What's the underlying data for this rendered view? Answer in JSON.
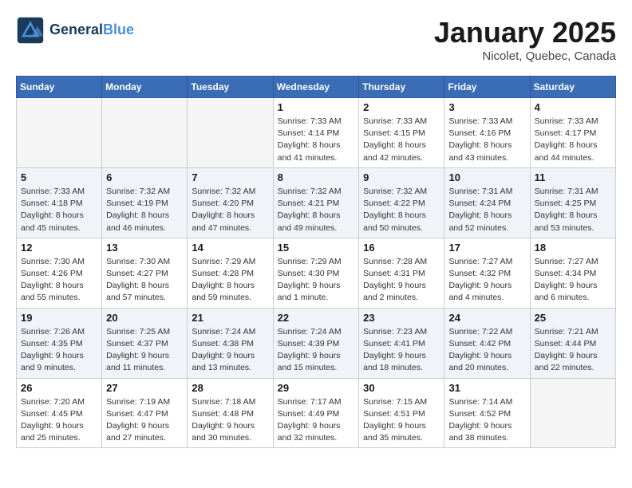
{
  "header": {
    "logo_line1": "General",
    "logo_line2": "Blue",
    "month": "January 2025",
    "location": "Nicolet, Quebec, Canada"
  },
  "weekdays": [
    "Sunday",
    "Monday",
    "Tuesday",
    "Wednesday",
    "Thursday",
    "Friday",
    "Saturday"
  ],
  "weeks": [
    [
      {
        "day": "",
        "info": ""
      },
      {
        "day": "",
        "info": ""
      },
      {
        "day": "",
        "info": ""
      },
      {
        "day": "1",
        "info": "Sunrise: 7:33 AM\nSunset: 4:14 PM\nDaylight: 8 hours and 41 minutes."
      },
      {
        "day": "2",
        "info": "Sunrise: 7:33 AM\nSunset: 4:15 PM\nDaylight: 8 hours and 42 minutes."
      },
      {
        "day": "3",
        "info": "Sunrise: 7:33 AM\nSunset: 4:16 PM\nDaylight: 8 hours and 43 minutes."
      },
      {
        "day": "4",
        "info": "Sunrise: 7:33 AM\nSunset: 4:17 PM\nDaylight: 8 hours and 44 minutes."
      }
    ],
    [
      {
        "day": "5",
        "info": "Sunrise: 7:33 AM\nSunset: 4:18 PM\nDaylight: 8 hours and 45 minutes."
      },
      {
        "day": "6",
        "info": "Sunrise: 7:32 AM\nSunset: 4:19 PM\nDaylight: 8 hours and 46 minutes."
      },
      {
        "day": "7",
        "info": "Sunrise: 7:32 AM\nSunset: 4:20 PM\nDaylight: 8 hours and 47 minutes."
      },
      {
        "day": "8",
        "info": "Sunrise: 7:32 AM\nSunset: 4:21 PM\nDaylight: 8 hours and 49 minutes."
      },
      {
        "day": "9",
        "info": "Sunrise: 7:32 AM\nSunset: 4:22 PM\nDaylight: 8 hours and 50 minutes."
      },
      {
        "day": "10",
        "info": "Sunrise: 7:31 AM\nSunset: 4:24 PM\nDaylight: 8 hours and 52 minutes."
      },
      {
        "day": "11",
        "info": "Sunrise: 7:31 AM\nSunset: 4:25 PM\nDaylight: 8 hours and 53 minutes."
      }
    ],
    [
      {
        "day": "12",
        "info": "Sunrise: 7:30 AM\nSunset: 4:26 PM\nDaylight: 8 hours and 55 minutes."
      },
      {
        "day": "13",
        "info": "Sunrise: 7:30 AM\nSunset: 4:27 PM\nDaylight: 8 hours and 57 minutes."
      },
      {
        "day": "14",
        "info": "Sunrise: 7:29 AM\nSunset: 4:28 PM\nDaylight: 8 hours and 59 minutes."
      },
      {
        "day": "15",
        "info": "Sunrise: 7:29 AM\nSunset: 4:30 PM\nDaylight: 9 hours and 1 minute."
      },
      {
        "day": "16",
        "info": "Sunrise: 7:28 AM\nSunset: 4:31 PM\nDaylight: 9 hours and 2 minutes."
      },
      {
        "day": "17",
        "info": "Sunrise: 7:27 AM\nSunset: 4:32 PM\nDaylight: 9 hours and 4 minutes."
      },
      {
        "day": "18",
        "info": "Sunrise: 7:27 AM\nSunset: 4:34 PM\nDaylight: 9 hours and 6 minutes."
      }
    ],
    [
      {
        "day": "19",
        "info": "Sunrise: 7:26 AM\nSunset: 4:35 PM\nDaylight: 9 hours and 9 minutes."
      },
      {
        "day": "20",
        "info": "Sunrise: 7:25 AM\nSunset: 4:37 PM\nDaylight: 9 hours and 11 minutes."
      },
      {
        "day": "21",
        "info": "Sunrise: 7:24 AM\nSunset: 4:38 PM\nDaylight: 9 hours and 13 minutes."
      },
      {
        "day": "22",
        "info": "Sunrise: 7:24 AM\nSunset: 4:39 PM\nDaylight: 9 hours and 15 minutes."
      },
      {
        "day": "23",
        "info": "Sunrise: 7:23 AM\nSunset: 4:41 PM\nDaylight: 9 hours and 18 minutes."
      },
      {
        "day": "24",
        "info": "Sunrise: 7:22 AM\nSunset: 4:42 PM\nDaylight: 9 hours and 20 minutes."
      },
      {
        "day": "25",
        "info": "Sunrise: 7:21 AM\nSunset: 4:44 PM\nDaylight: 9 hours and 22 minutes."
      }
    ],
    [
      {
        "day": "26",
        "info": "Sunrise: 7:20 AM\nSunset: 4:45 PM\nDaylight: 9 hours and 25 minutes."
      },
      {
        "day": "27",
        "info": "Sunrise: 7:19 AM\nSunset: 4:47 PM\nDaylight: 9 hours and 27 minutes."
      },
      {
        "day": "28",
        "info": "Sunrise: 7:18 AM\nSunset: 4:48 PM\nDaylight: 9 hours and 30 minutes."
      },
      {
        "day": "29",
        "info": "Sunrise: 7:17 AM\nSunset: 4:49 PM\nDaylight: 9 hours and 32 minutes."
      },
      {
        "day": "30",
        "info": "Sunrise: 7:15 AM\nSunset: 4:51 PM\nDaylight: 9 hours and 35 minutes."
      },
      {
        "day": "31",
        "info": "Sunrise: 7:14 AM\nSunset: 4:52 PM\nDaylight: 9 hours and 38 minutes."
      },
      {
        "day": "",
        "info": ""
      }
    ]
  ]
}
